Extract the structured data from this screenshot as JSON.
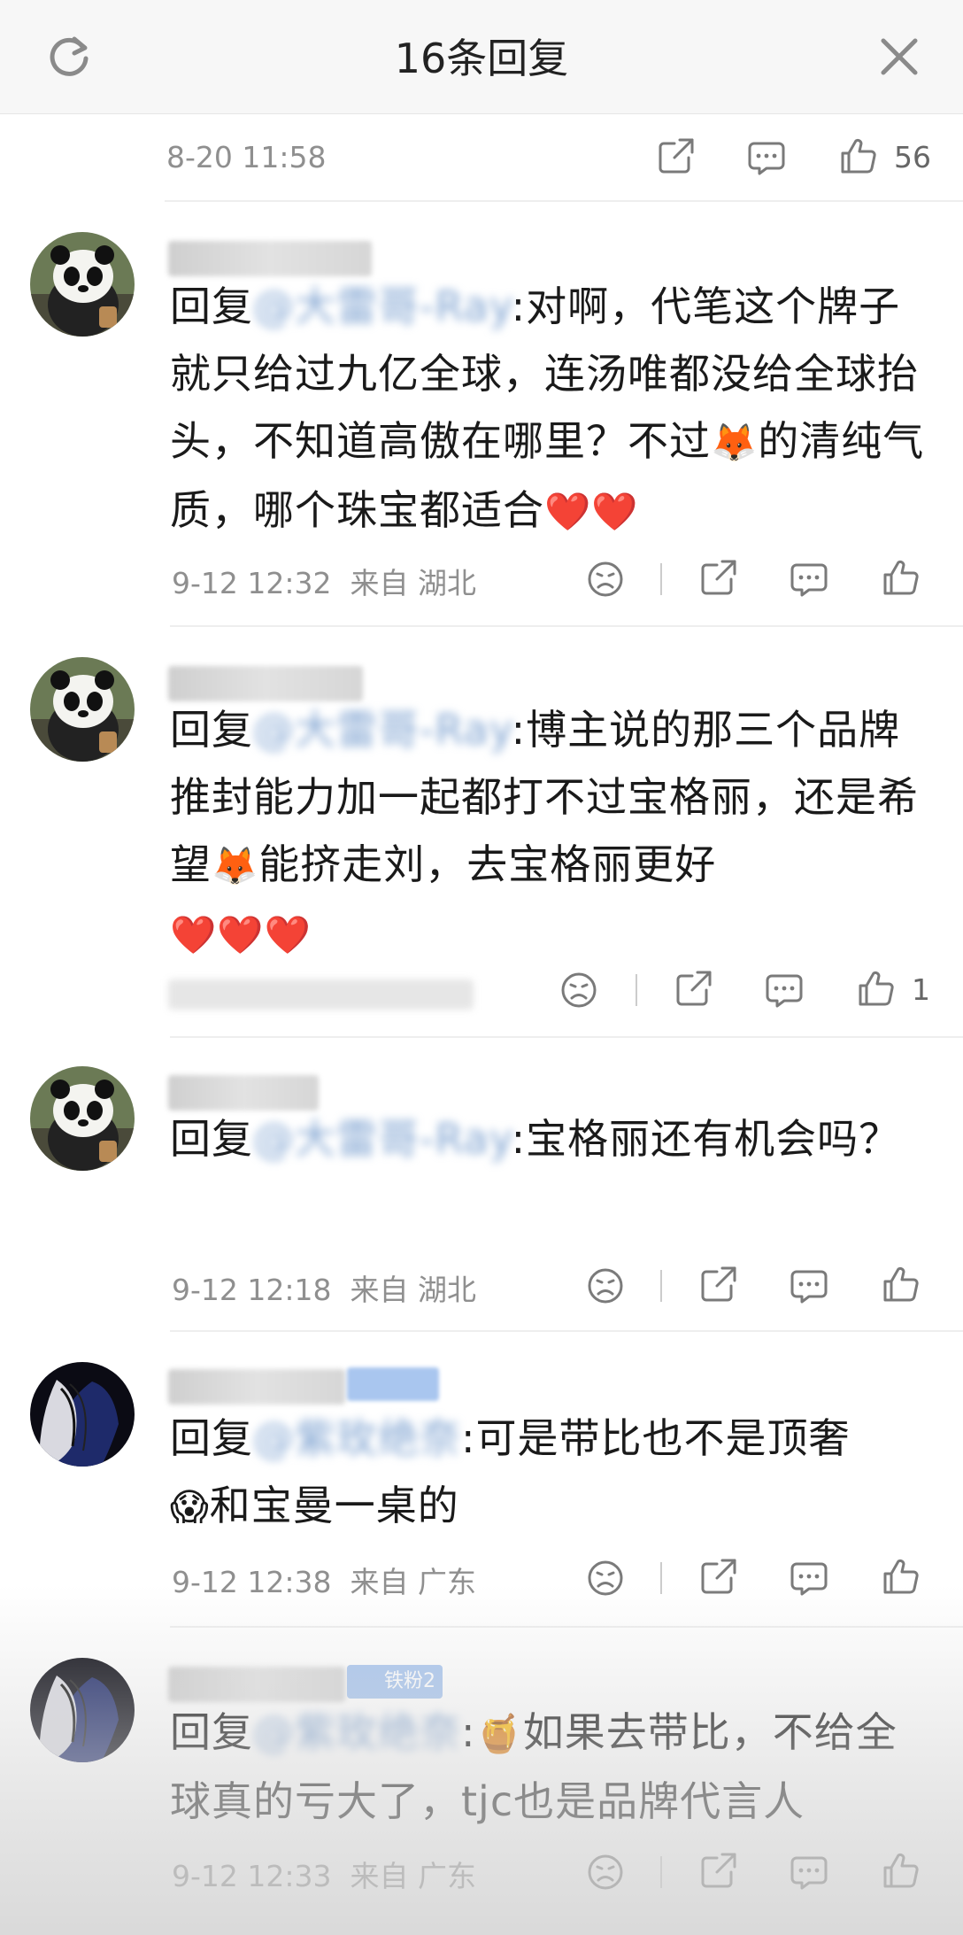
{
  "header": {
    "title": "16条回复"
  },
  "top": {
    "time": "8-20 11:58",
    "likes": "56"
  },
  "comments": [
    {
      "reply_prefix": "回复",
      "mention": "@大雷哥-Ray",
      "text": ":对啊，代笔这个牌子就只给过九亿全球，连汤唯都没给全球抬头，不知道高傲在哪里？不过",
      "emoji1": "🦊",
      "text2": "的清纯气质，哪个珠宝都适合",
      "hearts": "❤️❤️",
      "time": "9-12 12:32",
      "location": "来自 湖北",
      "likes": ""
    },
    {
      "reply_prefix": "回复",
      "mention": "@大雷哥-Ray",
      "text": ":博主说的那三个品牌推封能力加一起都打不过宝格丽，还是希望",
      "emoji1": "🦊",
      "text2": "能挤走刘，去宝格丽更好",
      "hearts": "❤️❤️❤️",
      "likes": "1"
    },
    {
      "reply_prefix": "回复",
      "mention": "@大雷哥-Ray",
      "text": ":宝格丽还有机会吗？",
      "time": "9-12 12:18",
      "location": "来自 湖北"
    },
    {
      "reply_prefix": "回复",
      "mention": "@紫玫绝奈",
      "text": ":可是带比也不是顶奢",
      "emoji1": "😱",
      "text2": "和宝曼一桌的",
      "time": "9-12 12:38",
      "location": "来自 广东"
    },
    {
      "reply_prefix": "回复",
      "mention": "@紫玫绝奈",
      "emoji1": "🍯",
      "text": "如果去带比，不给全球真的亏大了，tjc也是品牌代言人",
      "badge": "铁粉2",
      "time": "9-12 12:33",
      "location": "来自 广东"
    }
  ],
  "icons": [
    "refresh-icon",
    "close-icon",
    "share-icon",
    "comment-icon",
    "like-icon",
    "dislike-icon"
  ],
  "colors": {
    "mention": "#4f7fb8",
    "meta": "#8f8f8f",
    "badge": "#a9c6ef"
  }
}
